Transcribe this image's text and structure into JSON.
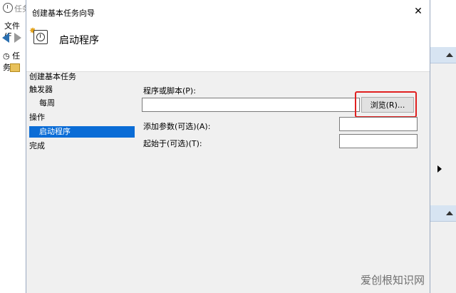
{
  "background_window": {
    "title": "任务",
    "menu_label": "文件(F",
    "tree_items": [
      "任务",
      ""
    ]
  },
  "dialog": {
    "title": "创建基本任务向导",
    "close_glyph": "✕",
    "header_title": "启动程序",
    "steps": [
      {
        "label": "创建基本任务",
        "indent": false,
        "active": false
      },
      {
        "label": "触发器",
        "indent": false,
        "active": false
      },
      {
        "label": "每周",
        "indent": true,
        "active": false
      },
      {
        "label": "操作",
        "indent": false,
        "active": false
      },
      {
        "label": "启动程序",
        "indent": true,
        "active": true
      },
      {
        "label": "完成",
        "indent": false,
        "active": false
      }
    ],
    "form": {
      "program_label": "程序或脚本(P):",
      "program_value": "",
      "browse_label": "浏览(R)...",
      "args_label": "添加参数(可选)(A):",
      "args_value": "",
      "start_in_label": "起始于(可选)(T):",
      "start_in_value": ""
    }
  },
  "watermark": "爱创根知识网",
  "colors": {
    "active_step": "#0a6cd6",
    "highlight_border": "#e02020",
    "dialog_bg": "#f0f0f0"
  }
}
